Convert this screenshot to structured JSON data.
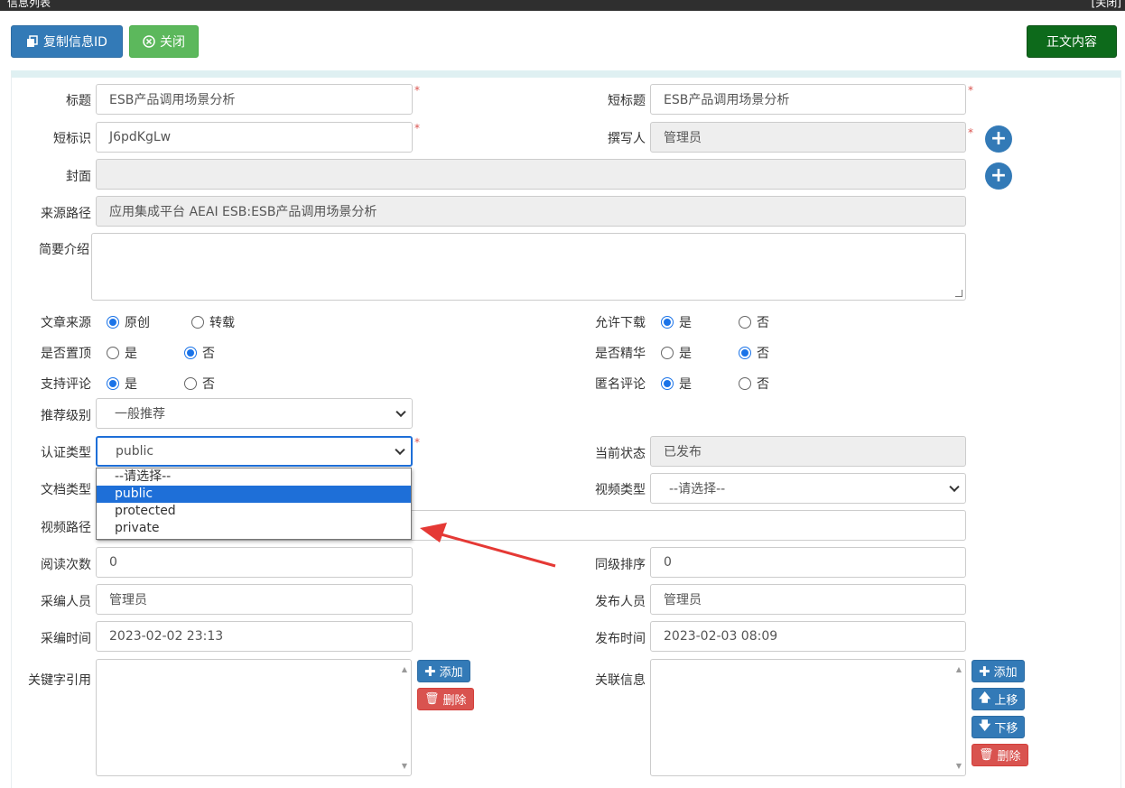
{
  "window": {
    "title": "信息列表",
    "close_label": "[关闭]"
  },
  "toolbar": {
    "copy_id_label": "复制信息ID",
    "close_label": "关闭",
    "content_label": "正文内容"
  },
  "fields": {
    "title": {
      "label": "标题",
      "value": "ESB产品调用场景分析"
    },
    "short_title": {
      "label": "短标题",
      "value": "ESB产品调用场景分析"
    },
    "short_id": {
      "label": "短标识",
      "value": "J6pdKgLw"
    },
    "author": {
      "label": "撰写人",
      "value": "管理员"
    },
    "cover": {
      "label": "封面",
      "value": ""
    },
    "source_path": {
      "label": "来源路径",
      "value": "应用集成平台 AEAI ESB:ESB产品调用场景分析"
    },
    "summary": {
      "label": "简要介绍",
      "value": ""
    },
    "article_source": {
      "label": "文章来源",
      "options": [
        "原创",
        "转载"
      ],
      "selected": "原创"
    },
    "allow_download": {
      "label": "允许下载",
      "options": [
        "是",
        "否"
      ],
      "selected": "是"
    },
    "pinned": {
      "label": "是否置顶",
      "options": [
        "是",
        "否"
      ],
      "selected": "否"
    },
    "featured": {
      "label": "是否精华",
      "options": [
        "是",
        "否"
      ],
      "selected": "否"
    },
    "allow_comment": {
      "label": "支持评论",
      "options": [
        "是",
        "否"
      ],
      "selected": "是"
    },
    "anonymous_comment": {
      "label": "匿名评论",
      "options": [
        "是",
        "否"
      ],
      "selected": "是"
    },
    "recommend_level": {
      "label": "推荐级别",
      "value": "一般推荐"
    },
    "auth_type": {
      "label": "认证类型",
      "value": "public",
      "options": [
        "--请选择--",
        "public",
        "protected",
        "private"
      ],
      "highlighted": "public"
    },
    "current_status": {
      "label": "当前状态",
      "value": "已发布"
    },
    "doc_type": {
      "label": "文档类型"
    },
    "video_type": {
      "label": "视频类型",
      "value": "--请选择--"
    },
    "video_path": {
      "label": "视频路径",
      "value": ""
    },
    "read_count": {
      "label": "阅读次数",
      "value": "0"
    },
    "sort_order": {
      "label": "同级排序",
      "value": "0"
    },
    "editor": {
      "label": "采编人员",
      "value": "管理员"
    },
    "publisher": {
      "label": "发布人员",
      "value": "管理员"
    },
    "edit_time": {
      "label": "采编时间",
      "value": "2023-02-02 23:13"
    },
    "publish_time": {
      "label": "发布时间",
      "value": "2023-02-03 08:09"
    },
    "keywords": {
      "label": "关键字引用"
    },
    "related": {
      "label": "关联信息"
    }
  },
  "actions": {
    "add_label": "添加",
    "delete_label": "删除",
    "up_label": "上移",
    "down_label": "下移"
  },
  "colors": {
    "primary": "#337ab7",
    "success": "#5cb85c",
    "dark_green": "#0d6a1b",
    "danger": "#d9534f",
    "arrow": "#e53935",
    "highlight": "#1e6fd8"
  }
}
